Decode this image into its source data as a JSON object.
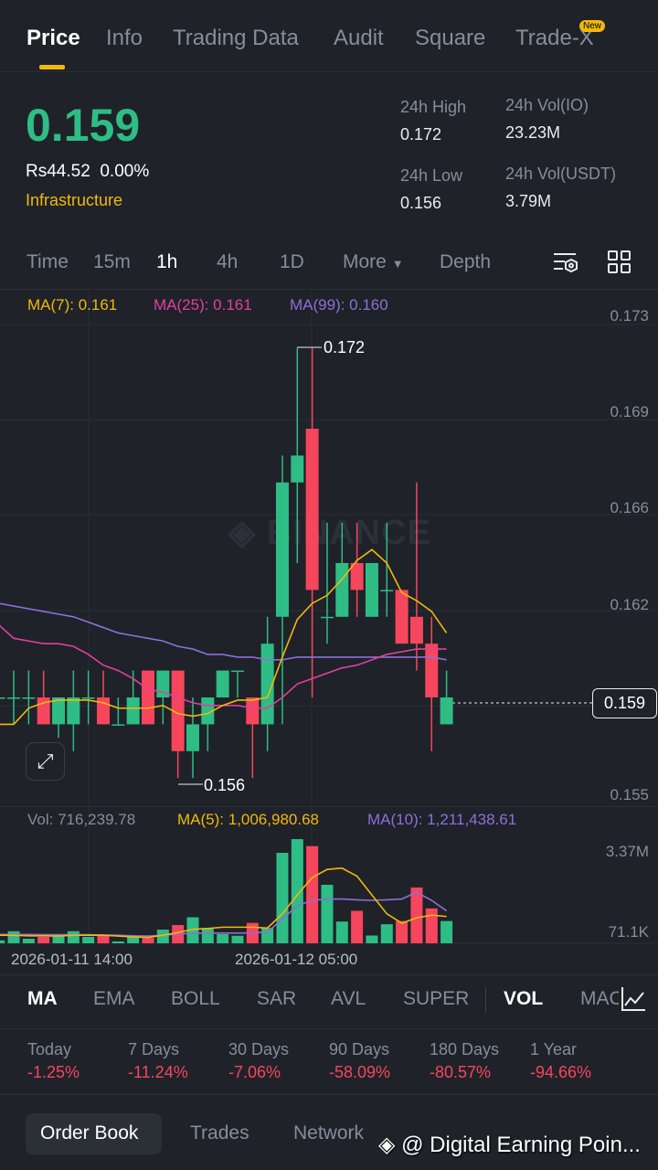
{
  "tabs": [
    "Price",
    "Info",
    "Trading Data",
    "Audit",
    "Square",
    "Trade-X"
  ],
  "new_badge": "New",
  "ticker": {
    "price": "0.159",
    "fiat": "Rs44.52",
    "change": "0.00%",
    "category": "Infrastructure"
  },
  "stats": [
    {
      "label": "24h High",
      "value": "0.172"
    },
    {
      "label": "24h Vol(IO)",
      "value": "23.23M"
    },
    {
      "label": "24h Low",
      "value": "0.156"
    },
    {
      "label": "24h Vol(USDT)",
      "value": "3.79M"
    }
  ],
  "intervals": [
    "Time",
    "15m",
    "1h",
    "4h",
    "1D",
    "More",
    "Depth"
  ],
  "ma_legend": {
    "ma7": "MA(7): 0.161",
    "ma25": "MA(25): 0.161",
    "ma99": "MA(99): 0.160"
  },
  "price_axis": [
    "0.173",
    "0.169",
    "0.166",
    "0.162",
    "0.159",
    "0.155"
  ],
  "current_price": "0.159",
  "high_marker": "0.172",
  "low_marker": "0.156",
  "watermark": "BINANCE",
  "vol_legend": {
    "vol": "Vol: 716,239.78",
    "ma5": "MA(5): 1,006,980.68",
    "ma10": "MA(10): 1,211,438.61"
  },
  "vol_axis": [
    "3.37M",
    "71.1K"
  ],
  "dates": [
    "2026-01-11 14:00",
    "2026-01-12 05:00"
  ],
  "indicators": [
    "MA",
    "EMA",
    "BOLL",
    "SAR",
    "AVL",
    "SUPER",
    "VOL",
    "MAC"
  ],
  "performance": [
    {
      "label": "Today",
      "value": "-1.25%"
    },
    {
      "label": "7 Days",
      "value": "-11.24%"
    },
    {
      "label": "30 Days",
      "value": "-7.06%"
    },
    {
      "label": "90 Days",
      "value": "-58.09%"
    },
    {
      "label": "180 Days",
      "value": "-80.57%"
    },
    {
      "label": "1 Year",
      "value": "-94.66%"
    }
  ],
  "bottom_tabs": [
    "Order Book",
    "Trades",
    "Network"
  ],
  "credit": "@ Digital Earning Poin...",
  "colors": {
    "up": "#2ebd85",
    "down": "#f6465d",
    "ma7": "#f0b90b",
    "ma25": "#e040a0",
    "ma99": "#8e6fd8",
    "accent": "#f0b90b"
  },
  "chart_data": {
    "type": "candlestick",
    "interval": "1h",
    "ylim": [
      0.155,
      0.173
    ],
    "ohlc": [
      [
        0.159,
        0.16,
        0.159,
        0.159
      ],
      [
        0.159,
        0.16,
        0.158,
        0.159
      ],
      [
        0.159,
        0.16,
        0.158,
        0.159
      ],
      [
        0.159,
        0.16,
        0.158,
        0.158
      ],
      [
        0.158,
        0.159,
        0.1575,
        0.159
      ],
      [
        0.158,
        0.16,
        0.157,
        0.159
      ],
      [
        0.159,
        0.16,
        0.158,
        0.159
      ],
      [
        0.159,
        0.16,
        0.158,
        0.158
      ],
      [
        0.158,
        0.159,
        0.158,
        0.158
      ],
      [
        0.158,
        0.16,
        0.158,
        0.159
      ],
      [
        0.16,
        0.16,
        0.158,
        0.158
      ],
      [
        0.159,
        0.16,
        0.158,
        0.16
      ],
      [
        0.16,
        0.16,
        0.156,
        0.157
      ],
      [
        0.157,
        0.159,
        0.156,
        0.158
      ],
      [
        0.158,
        0.159,
        0.157,
        0.159
      ],
      [
        0.159,
        0.16,
        0.159,
        0.16
      ],
      [
        0.16,
        0.16,
        0.159,
        0.16
      ],
      [
        0.159,
        0.159,
        0.156,
        0.158
      ],
      [
        0.158,
        0.162,
        0.157,
        0.161
      ],
      [
        0.162,
        0.168,
        0.158,
        0.167
      ],
      [
        0.167,
        0.172,
        0.164,
        0.168
      ],
      [
        0.169,
        0.172,
        0.159,
        0.163
      ],
      [
        0.162,
        0.1655,
        0.161,
        0.162
      ],
      [
        0.162,
        0.1655,
        0.162,
        0.164
      ],
      [
        0.164,
        0.1655,
        0.162,
        0.163
      ],
      [
        0.162,
        0.164,
        0.162,
        0.164
      ],
      [
        0.163,
        0.1655,
        0.162,
        0.163
      ],
      [
        0.163,
        0.163,
        0.161,
        0.161
      ],
      [
        0.162,
        0.167,
        0.16,
        0.161
      ],
      [
        0.161,
        0.162,
        0.157,
        0.159
      ],
      [
        0.158,
        0.16,
        0.158,
        0.159
      ]
    ],
    "ma7": [
      0.158,
      0.158,
      0.1586,
      0.1588,
      0.1589,
      0.1589,
      0.1589,
      0.1588,
      0.1586,
      0.1586,
      0.1586,
      0.1587,
      0.1584,
      0.1583,
      0.1584,
      0.1587,
      0.1589,
      0.1589,
      0.159,
      0.1605,
      0.1619,
      0.1625,
      0.1628,
      0.1634,
      0.1641,
      0.1645,
      0.164,
      0.1629,
      0.1626,
      0.1622,
      0.1614
    ],
    "ma25": [
      0.1617,
      0.1612,
      0.1611,
      0.161,
      0.161,
      0.1609,
      0.1606,
      0.1602,
      0.16,
      0.1597,
      0.1593,
      0.1592,
      0.159,
      0.1588,
      0.1587,
      0.1587,
      0.1587,
      0.1586,
      0.1586,
      0.159,
      0.1595,
      0.1597,
      0.1599,
      0.1601,
      0.1602,
      0.1604,
      0.1606,
      0.1607,
      0.1608,
      0.1608,
      0.1608
    ],
    "ma99": [
      0.1625,
      0.1624,
      0.1623,
      0.1622,
      0.1621,
      0.162,
      0.1618,
      0.1616,
      0.1614,
      0.1613,
      0.1612,
      0.1611,
      0.1609,
      0.1608,
      0.1606,
      0.1606,
      0.1605,
      0.1605,
      0.1604,
      0.1604,
      0.1605,
      0.1605,
      0.1605,
      0.1605,
      0.1605,
      0.1605,
      0.1605,
      0.1605,
      0.1605,
      0.1605,
      0.1604
    ],
    "volume_m": [
      0.11,
      0.45,
      0.17,
      0.24,
      0.32,
      0.45,
      0.24,
      0.29,
      0.07,
      0.24,
      0.2,
      0.51,
      0.68,
      0.97,
      0.57,
      0.34,
      0.28,
      0.76,
      0.57,
      3.37,
      3.88,
      3.62,
      2.18,
      0.81,
      1.21,
      0.29,
      0.71,
      0.83,
      2.08,
      1.3,
      0.83
    ],
    "vol_ma5_m": [
      0.3,
      0.3,
      0.28,
      0.28,
      0.27,
      0.3,
      0.3,
      0.3,
      0.27,
      0.24,
      0.22,
      0.3,
      0.4,
      0.52,
      0.55,
      0.6,
      0.6,
      0.6,
      0.57,
      1.1,
      1.8,
      2.45,
      2.75,
      2.8,
      2.5,
      1.8,
      1.1,
      0.75,
      0.95,
      1.05,
      1.0
    ],
    "vol_ma10_m": [
      0.33,
      0.33,
      0.33,
      0.32,
      0.32,
      0.32,
      0.32,
      0.31,
      0.3,
      0.28,
      0.27,
      0.3,
      0.35,
      0.37,
      0.38,
      0.38,
      0.38,
      0.39,
      0.42,
      0.9,
      1.4,
      1.6,
      1.65,
      1.65,
      1.62,
      1.6,
      1.62,
      1.65,
      1.9,
      1.6,
      1.21
    ]
  }
}
